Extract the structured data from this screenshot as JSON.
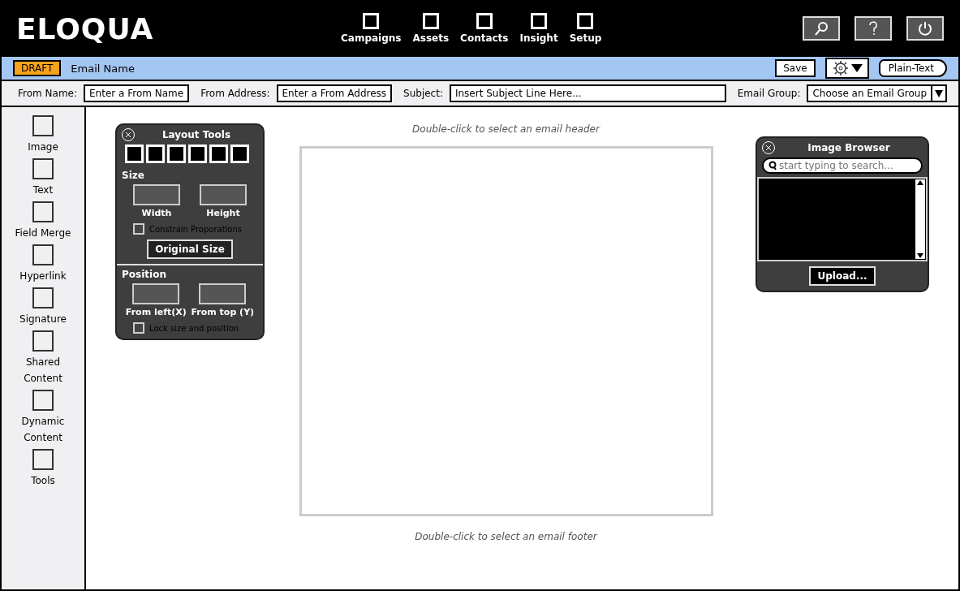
{
  "header": {
    "logo": "ELOQUA",
    "nav": [
      {
        "label": "Campaigns"
      },
      {
        "label": "Assets"
      },
      {
        "label": "Contacts"
      },
      {
        "label": "Insight"
      },
      {
        "label": "Setup"
      }
    ]
  },
  "email_bar": {
    "status": "DRAFT",
    "name": "Email Name",
    "save": "Save",
    "plain_text": "Plain-Text"
  },
  "fields": [
    {
      "label": "From Name:",
      "kind": "input",
      "value": "Enter a From Name"
    },
    {
      "label": "From Address:",
      "kind": "input",
      "value": "Enter a From Address"
    },
    {
      "label": "Subject:",
      "kind": "input",
      "value": "Insert Subject Line Here..."
    },
    {
      "label": "Email Group:",
      "kind": "select",
      "value": "Choose an Email Group"
    }
  ],
  "sidebar": {
    "items": [
      {
        "label": "Image"
      },
      {
        "label": "Text"
      },
      {
        "label": "Field Merge"
      },
      {
        "label": "Hyperlink"
      },
      {
        "label": "Signature"
      },
      {
        "label": "Shared Content"
      },
      {
        "label": "Dynamic Content"
      },
      {
        "label": "Tools"
      }
    ]
  },
  "canvas": {
    "header_hint": "Double-click to select an email header",
    "footer_hint": "Double-click to select an email footer"
  },
  "layout_tools": {
    "title": "Layout Tools",
    "size_heading": "Size",
    "size_fields": [
      "Width",
      "Height"
    ],
    "constrain": {
      "label": "Constrain Proporations",
      "checked": false
    },
    "original_size": "Original Size",
    "position_heading": "Position",
    "position_fields": [
      "From left(X)",
      "From top (Y)"
    ],
    "lock": {
      "label": "Lock size and position",
      "checked": false
    }
  },
  "image_browser": {
    "title": "Image Browser",
    "search_placeholder": "start typing to search...",
    "upload": "Upload..."
  }
}
